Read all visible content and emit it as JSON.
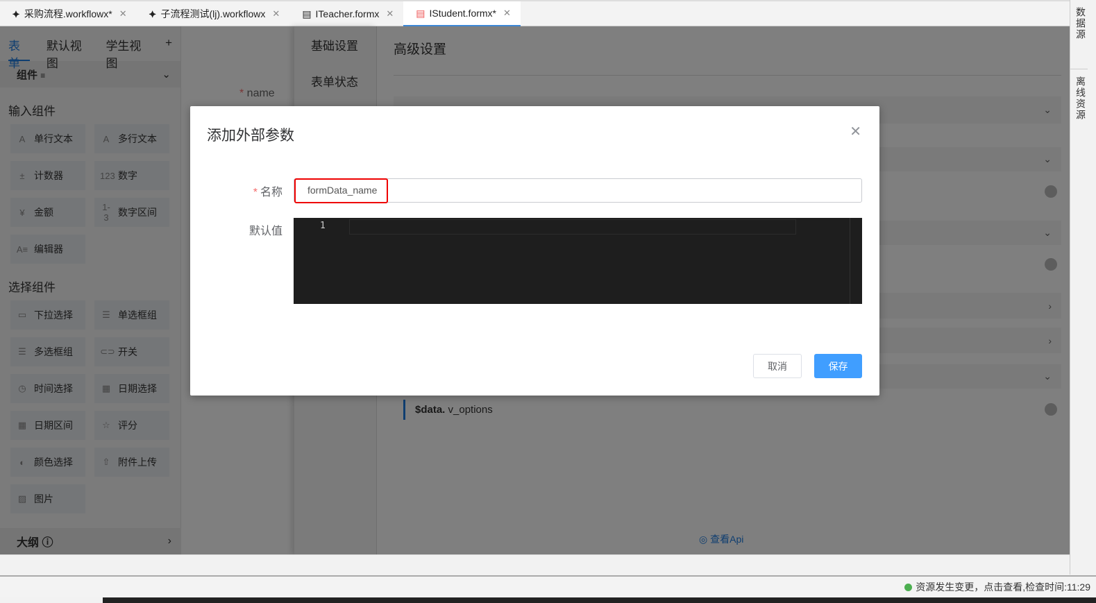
{
  "tabs": [
    {
      "label": "采购流程.workflowx*",
      "icon": "workflow-icon"
    },
    {
      "label": "子流程测试(lj).workflowx",
      "icon": "workflow-icon"
    },
    {
      "label": "ITeacher.formx",
      "icon": "form-file-icon"
    },
    {
      "label": "IStudent.formx*",
      "icon": "form-file-icon",
      "active": true
    }
  ],
  "left": {
    "view_tabs": [
      "表单",
      "默认视图",
      "学生视图",
      "+"
    ],
    "components_title": "组件",
    "input_section": "输入组件",
    "input_items": [
      {
        "icon": "A",
        "label": "单行文本"
      },
      {
        "icon": "A",
        "label": "多行文本"
      },
      {
        "icon": "±",
        "label": "计数器"
      },
      {
        "icon": "123",
        "label": "数字"
      },
      {
        "icon": "¥",
        "label": "金额"
      },
      {
        "icon": "1-3",
        "label": "数字区间"
      },
      {
        "icon": "A≡",
        "label": "编辑器"
      }
    ],
    "select_section": "选择组件",
    "select_items": [
      {
        "icon": "▭",
        "label": "下拉选择"
      },
      {
        "icon": "☰",
        "label": "单选框组"
      },
      {
        "icon": "☰",
        "label": "多选框组"
      },
      {
        "icon": "⊂⊃",
        "label": "开关"
      },
      {
        "icon": "◷",
        "label": "时间选择"
      },
      {
        "icon": "▦",
        "label": "日期选择"
      },
      {
        "icon": "▦",
        "label": "日期区间"
      },
      {
        "icon": "☆",
        "label": "评分"
      },
      {
        "icon": "◐",
        "label": "颜色选择"
      },
      {
        "icon": "⇧",
        "label": "附件上传"
      },
      {
        "icon": "▨",
        "label": "图片"
      }
    ],
    "outline": "大纲"
  },
  "canvas": {
    "field_label": "name"
  },
  "settings_nav": [
    "基础设置",
    "表单状态"
  ],
  "advanced": {
    "title": "高级设置",
    "data_item_prefix": "$data.",
    "data_item_name": "v_options",
    "view_api": "查看Api"
  },
  "right_panel": [
    "数据源",
    "离线资源"
  ],
  "dialog": {
    "title": "添加外部参数",
    "name_label": "名称",
    "name_value": "formData_name",
    "default_label": "默认值",
    "line_number": "1",
    "cancel": "取消",
    "save": "保存"
  },
  "status": {
    "text": "资源发生变更，点击查看,检查时间:11:29",
    "color": "#4caf50"
  }
}
